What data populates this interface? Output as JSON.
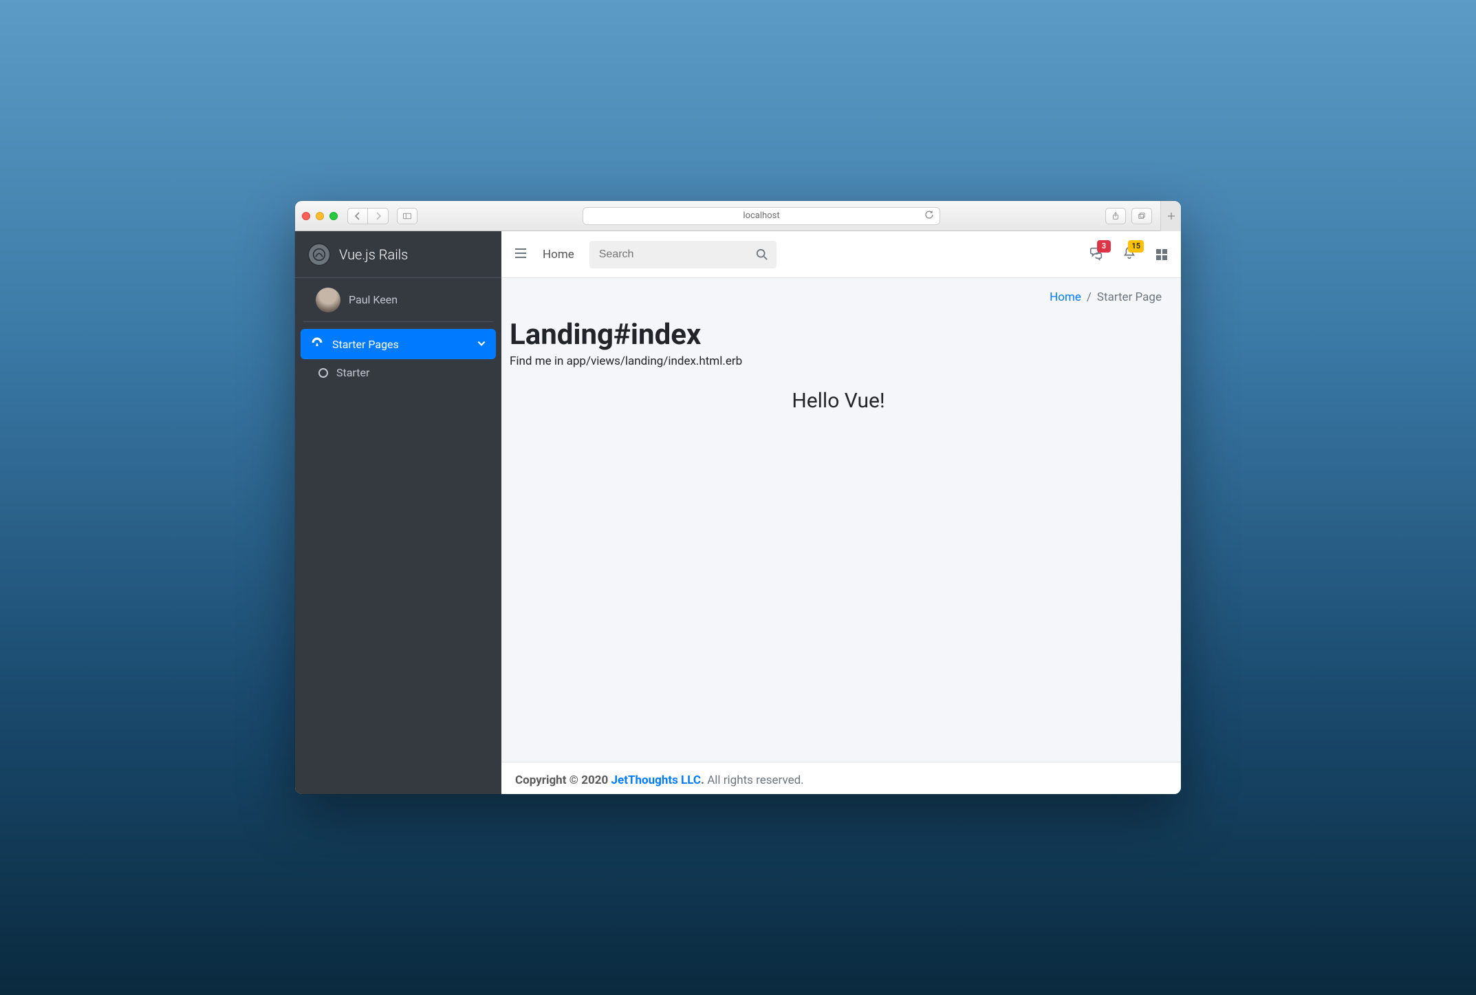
{
  "browser": {
    "url_display": "localhost"
  },
  "sidebar": {
    "brand": "Vue.js Rails",
    "user_name": "Paul Keen",
    "menu": {
      "starter_pages_label": "Starter Pages",
      "starter_label": "Starter"
    }
  },
  "topnav": {
    "home_label": "Home",
    "search_placeholder": "Search",
    "messages_badge": "3",
    "notifications_badge": "15"
  },
  "breadcrumbs": {
    "home": "Home",
    "sep": "/",
    "current": "Starter Page"
  },
  "page": {
    "title": "Landing#index",
    "subtitle": "Find me in app/views/landing/index.html.erb",
    "hello": "Hello Vue!"
  },
  "footer": {
    "copyright_strong": "Copyright © 2020 ",
    "link_text": "JetThoughts LLC",
    "period": ".",
    "rest": " All rights reserved."
  }
}
